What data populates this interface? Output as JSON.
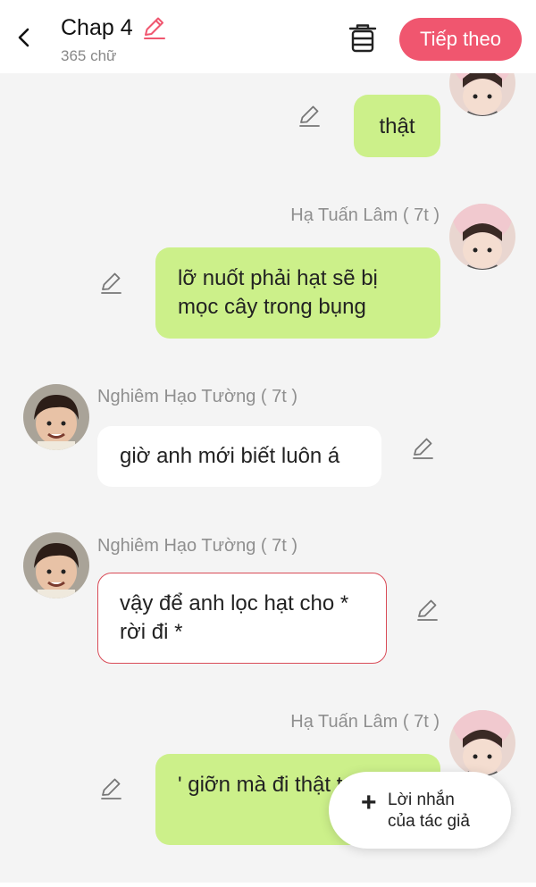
{
  "header": {
    "title": "Chap 4",
    "word_count": "365 chữ",
    "next_label": "Tiếp theo"
  },
  "messages": [
    {
      "sender": "",
      "text": "thật",
      "side": "right"
    },
    {
      "sender": "Hạ Tuấn Lâm ( 7t )",
      "text": "lỡ nuốt phải hạt sẽ bị mọc cây trong bụng",
      "side": "right"
    },
    {
      "sender": "Nghiêm Hạo Tường ( 7t )",
      "text": "giờ anh mới biết luôn á",
      "side": "left"
    },
    {
      "sender": "Nghiêm Hạo Tường ( 7t )",
      "text": "vậy để anh lọc hạt cho * rời đi *",
      "side": "left"
    },
    {
      "sender": "Hạ Tuấn Lâm ( 7t )",
      "text": "' giỡn mà đi thật trời '",
      "side": "right"
    }
  ],
  "fab": {
    "line1": "Lời nhắn",
    "line2": "của tác giả"
  },
  "colors": {
    "accent": "#f0566f",
    "bubble_green": "#ccf08a",
    "outline_red": "#d94b57"
  },
  "icons": [
    "back-icon",
    "edit-pencil-icon",
    "trash-icon",
    "plus-icon"
  ]
}
